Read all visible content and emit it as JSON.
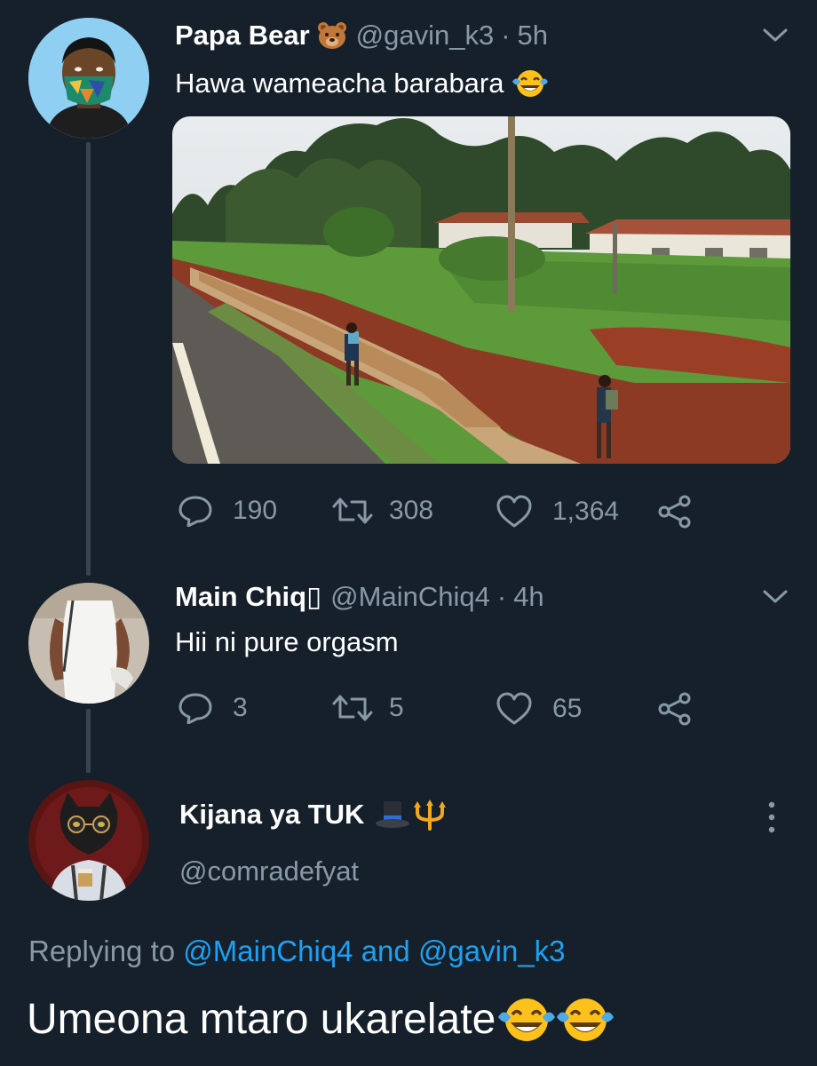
{
  "tweets": [
    {
      "name": "Papa Bear",
      "name_emoji": "bear-face-emoji",
      "handle": "@gavin_k3",
      "separator": "·",
      "time": "5h",
      "text": "Hawa wameacha barabara",
      "text_emoji": "face-with-tears-of-joy-emoji",
      "has_photo": true,
      "replies": "190",
      "retweets": "308",
      "likes": "1,364"
    },
    {
      "name": "Main Chiq",
      "name_suffix": "▯",
      "handle": "@MainChiq4",
      "separator": "·",
      "time": "4h",
      "text": "Hii ni pure orgasm",
      "replies": "3",
      "retweets": "5",
      "likes": "65"
    }
  ],
  "focused_tweet": {
    "name": "Kijana ya TUK",
    "name_emojis": [
      "top-hat-emoji",
      "trident-emoji"
    ],
    "handle": "@comradefyat",
    "replying_prefix": "Replying to",
    "replying_to": [
      "@MainChiq4",
      "@gavin_k3"
    ],
    "replying_joiner": "and",
    "text": "Umeona mtaro ukarelate",
    "text_emojis": [
      "face-with-tears-of-joy-emoji",
      "face-with-tears-of-joy-emoji"
    ]
  },
  "colors": {
    "background": "#15202b",
    "secondary_text": "#8899a6",
    "link": "#1da1f2",
    "thread_line": "#38444d"
  }
}
